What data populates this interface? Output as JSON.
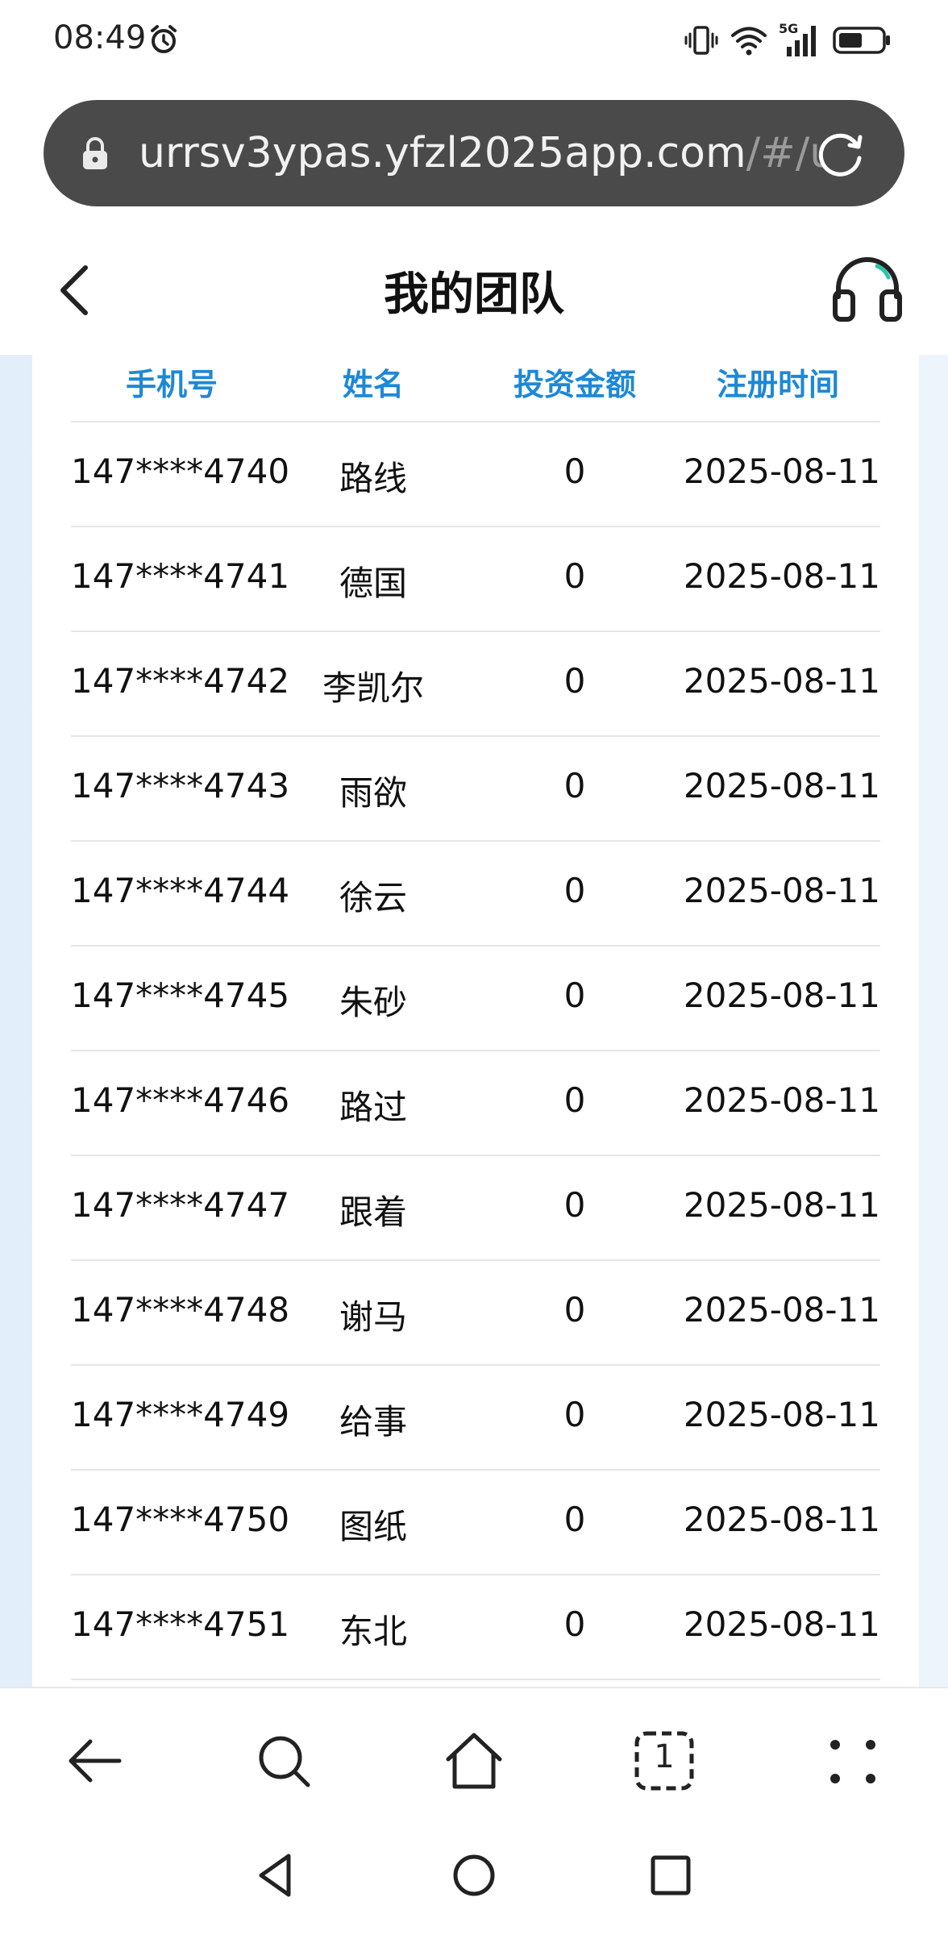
{
  "status_bar": {
    "time": "08:49",
    "network": "5G"
  },
  "browser": {
    "url_host": "urrsv3ypas.yfzl2025app.com",
    "url_path": "/#/us"
  },
  "header": {
    "title": "我的团队"
  },
  "table": {
    "columns": [
      "手机号",
      "姓名",
      "投资金额",
      "注册时间"
    ],
    "rows": [
      {
        "phone": "147****4740",
        "name": "路线",
        "amount": "0",
        "date": "2025-08-11"
      },
      {
        "phone": "147****4741",
        "name": "德国",
        "amount": "0",
        "date": "2025-08-11"
      },
      {
        "phone": "147****4742",
        "name": "李凯尔",
        "amount": "0",
        "date": "2025-08-11"
      },
      {
        "phone": "147****4743",
        "name": "雨欲",
        "amount": "0",
        "date": "2025-08-11"
      },
      {
        "phone": "147****4744",
        "name": "徐云",
        "amount": "0",
        "date": "2025-08-11"
      },
      {
        "phone": "147****4745",
        "name": "朱砂",
        "amount": "0",
        "date": "2025-08-11"
      },
      {
        "phone": "147****4746",
        "name": "路过",
        "amount": "0",
        "date": "2025-08-11"
      },
      {
        "phone": "147****4747",
        "name": "跟着",
        "amount": "0",
        "date": "2025-08-11"
      },
      {
        "phone": "147****4748",
        "name": "谢马",
        "amount": "0",
        "date": "2025-08-11"
      },
      {
        "phone": "147****4749",
        "name": "给事",
        "amount": "0",
        "date": "2025-08-11"
      },
      {
        "phone": "147****4750",
        "name": "图纸",
        "amount": "0",
        "date": "2025-08-11"
      },
      {
        "phone": "147****4751",
        "name": "东北",
        "amount": "0",
        "date": "2025-08-11"
      }
    ]
  },
  "toolbar": {
    "tab_count": "1"
  },
  "colors": {
    "accent": "#1e88d6",
    "url_bar": "#4a4a4a"
  },
  "icons": {
    "alarm": "alarm-icon",
    "vibrate": "vibrate-icon",
    "wifi": "wifi-icon",
    "signal": "signal-icon",
    "battery": "battery-icon",
    "lock": "lock-icon",
    "reload": "reload-icon",
    "back": "back-chevron-icon",
    "support": "headset-icon",
    "toolbar_back": "arrow-left-icon",
    "toolbar_search": "search-icon",
    "toolbar_home": "home-icon",
    "toolbar_tabs": "tabs-icon",
    "toolbar_menu": "menu-dots-icon",
    "nav_back": "nav-back-icon",
    "nav_home": "nav-home-icon",
    "nav_recents": "nav-recents-icon"
  }
}
